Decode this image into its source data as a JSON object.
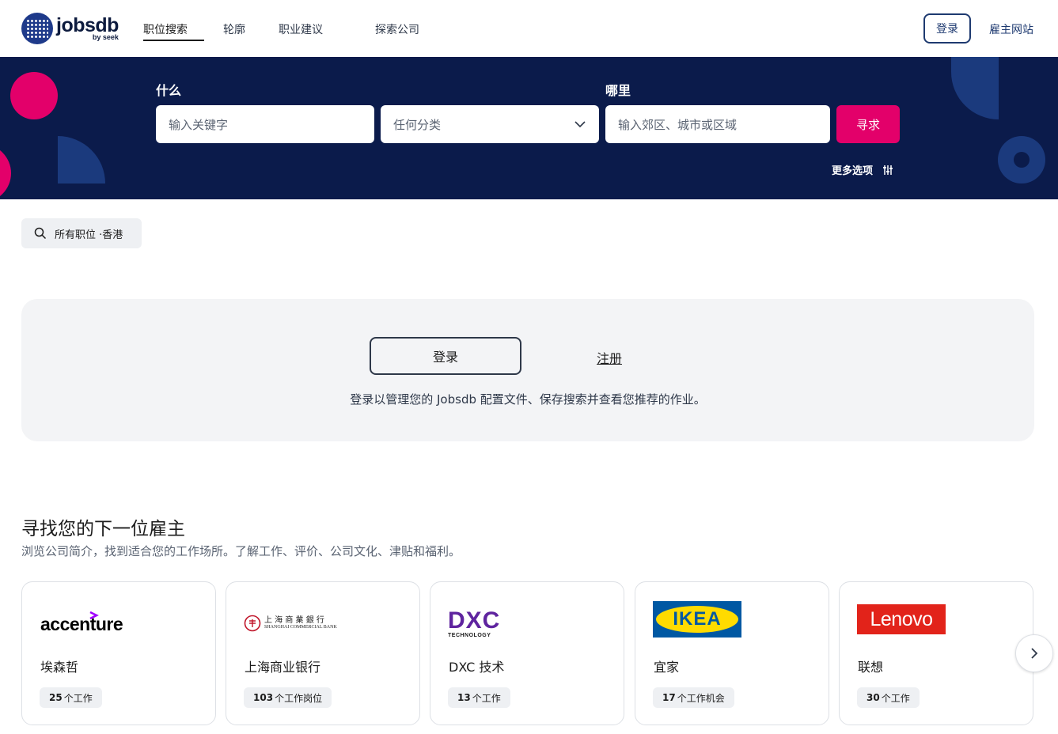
{
  "brand": {
    "name": "jobsdb",
    "sub": "by seek"
  },
  "nav": {
    "items": [
      "职位搜索",
      "轮廓",
      "职业建议",
      "探索公司"
    ],
    "login": "登录",
    "employer": "雇主网站"
  },
  "search": {
    "what_label": "什么",
    "where_label": "哪里",
    "keyword_placeholder": "输入关键字",
    "category_value": "任何分类",
    "location_placeholder": "输入郊区、城市或区域",
    "button": "寻求",
    "more_options": "更多选项"
  },
  "chip": {
    "text": "所有职位 ·香港"
  },
  "panel": {
    "login": "登录",
    "register": "注册",
    "message": "登录以管理您的 Jobsdb 配置文件、保存搜索并查看您推荐的作业。"
  },
  "employers": {
    "title": "寻找您的下一位雇主",
    "subtitle": "浏览公司简介，找到适合您的工作场所。了解工作、评价、公司文化、津贴和福利。",
    "cards": [
      {
        "logo_text": "accenture",
        "name": "埃森哲",
        "count": "25",
        "count_suffix": "个工作"
      },
      {
        "logo_text": "上 海 商 業 銀 行",
        "logo_sub": "SHANGHAI COMMERCIAL BANK",
        "name": "上海商业银行",
        "count": "103",
        "count_suffix": "个工作岗位"
      },
      {
        "logo_text": "DXC",
        "logo_sub": "TECHNOLOGY",
        "name": "DXC 技术",
        "count": "13",
        "count_suffix": "个工作"
      },
      {
        "logo_text": "IKEA",
        "name": "宜家",
        "count": "17",
        "count_suffix": "个工作机会"
      },
      {
        "logo_text": "Lenovo",
        "name": "联想",
        "count": "30",
        "count_suffix": "个工作"
      }
    ]
  },
  "colors": {
    "navy": "#0b1b4b",
    "pink": "#e3006a",
    "link": "#1e3a70"
  }
}
